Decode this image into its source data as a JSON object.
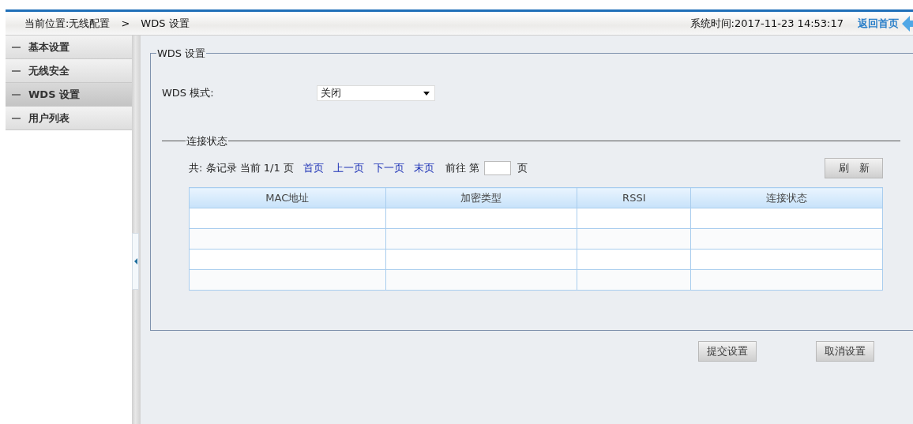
{
  "header": {
    "location_label": "当前位置:无线配置",
    "separator": ">",
    "current_page": "WDS 设置",
    "system_time": "系统时间:2017-11-23 14:53:17",
    "home_link": "返回首页"
  },
  "sidebar": {
    "items": [
      {
        "label": "基本设置",
        "selected": false
      },
      {
        "label": "无线安全",
        "selected": false
      },
      {
        "label": "WDS 设置",
        "selected": true
      },
      {
        "label": "用户列表",
        "selected": false
      }
    ]
  },
  "panel": {
    "title": "WDS 设置",
    "mode_label": "WDS 模式:",
    "mode_value": "关闭",
    "status": {
      "title": "连接状态",
      "pager": {
        "summary": "共: 条记录 当前 1/1 页",
        "links": [
          "首页",
          "上一页",
          "下一页",
          "末页"
        ],
        "goto_label": "前往 第",
        "goto_suffix": "页"
      },
      "refresh_button": "刷　新",
      "table": {
        "columns": [
          "MAC地址",
          "加密类型",
          "RSSI",
          "连接状态"
        ],
        "rows": [
          {
            "kind": "empty"
          },
          {
            "kind": "empty"
          },
          {
            "kind": "empty"
          },
          {
            "kind": "empty"
          }
        ]
      }
    }
  },
  "buttons": [
    "提交设置",
    "取消设置"
  ]
}
